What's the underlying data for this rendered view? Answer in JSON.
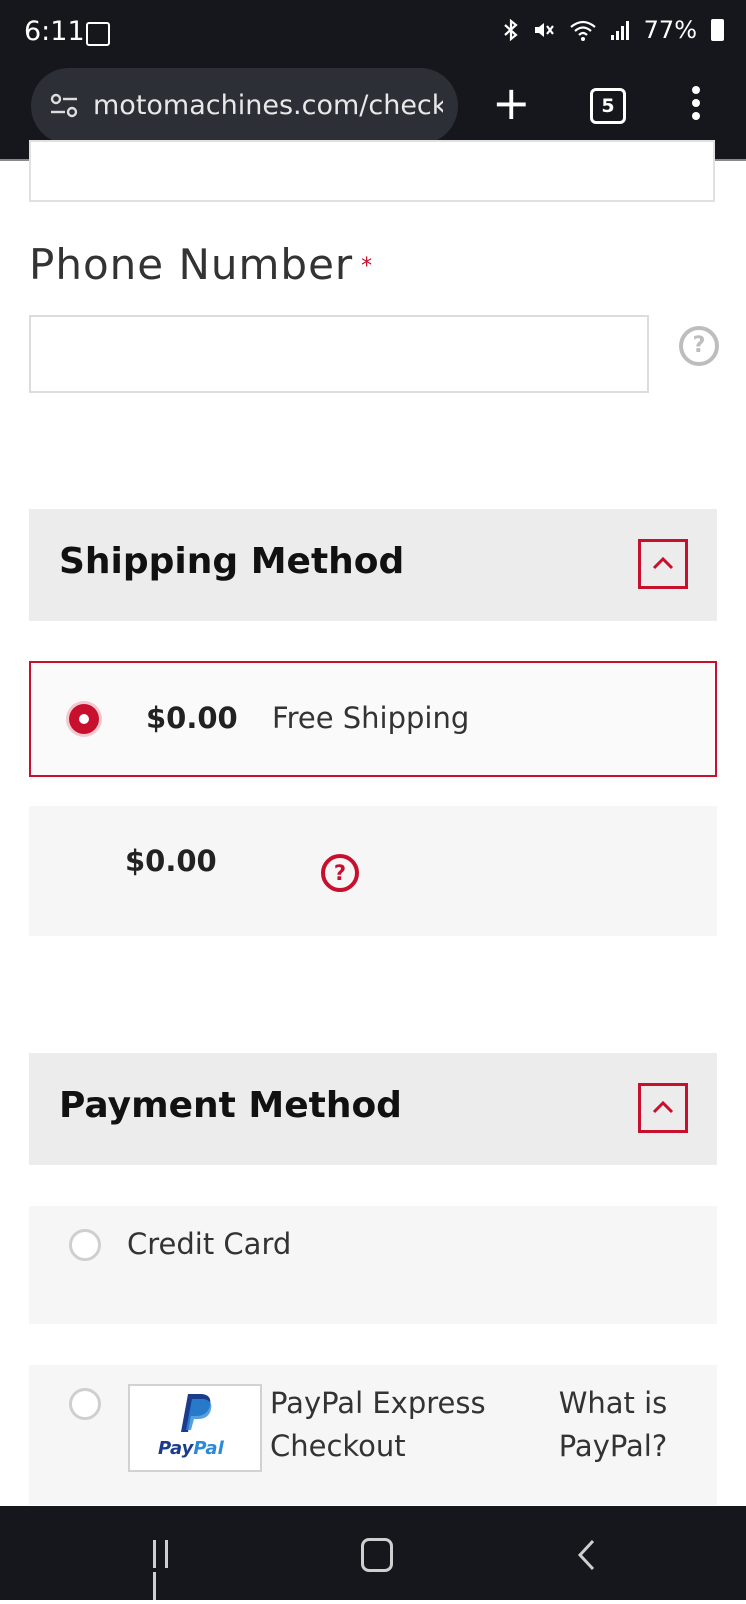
{
  "status_bar": {
    "time": "6:11",
    "battery": "77%",
    "icons": [
      "image-icon",
      "bluetooth-icon",
      "mute-icon",
      "wifi-icon",
      "signal-icon",
      "battery-icon"
    ]
  },
  "browser": {
    "url": "motomachines.com/checkout",
    "tab_count": "5",
    "new_tab_icon": "plus-icon",
    "menu_icon": "kebab-icon"
  },
  "form": {
    "phone": {
      "label": "Phone Number",
      "required_mark": "*",
      "value": "",
      "help_icon": "question-icon"
    }
  },
  "shipping": {
    "title": "Shipping Method",
    "collapse_icon": "chevron-up-icon",
    "options": [
      {
        "price": "$0.00",
        "name": "Free Shipping",
        "selected": true
      },
      {
        "price": "$0.00",
        "name": "",
        "selected": false,
        "help_icon": "question-icon"
      }
    ]
  },
  "payment": {
    "title": "Payment Method",
    "collapse_icon": "chevron-up-icon",
    "options": [
      {
        "label": "Credit Card",
        "selected": false
      },
      {
        "label_line1": "PayPal Express",
        "label_line2": "Checkout",
        "logo_text_a": "Pay",
        "logo_text_b": "Pal",
        "link_line1": "What is",
        "link_line2": "PayPal?",
        "selected": false
      }
    ]
  },
  "colors": {
    "accent": "#c8102e",
    "chrome_bg": "#15171c",
    "section_bg": "#ececec",
    "option_bg": "#f6f6f6"
  },
  "nav_bar": {
    "icons": [
      "recents-icon",
      "home-icon",
      "back-icon"
    ]
  }
}
